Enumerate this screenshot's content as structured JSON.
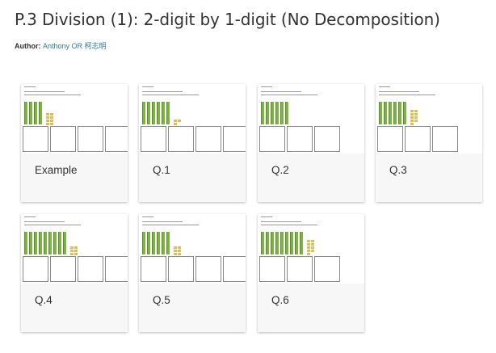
{
  "page": {
    "title": "P.3 Division (1): 2-digit by 1-digit (No Decomposition)",
    "author_label": "Author:",
    "author_name": "Anthony OR 柯志明"
  },
  "colors": {
    "tens_rod": "#7cb342",
    "ones_cube": "#e2bd55",
    "author_link": "#2a7d8f"
  },
  "cards": [
    {
      "label": "Example",
      "tens": 4,
      "ones": 8,
      "boxes": 4
    },
    {
      "label": "Q.1",
      "tens": 6,
      "ones": 3,
      "boxes": 4
    },
    {
      "label": "Q.2",
      "tens": 6,
      "ones": 0,
      "boxes": 3
    },
    {
      "label": "Q.3",
      "tens": 6,
      "ones": 9,
      "boxes": 3
    },
    {
      "label": "Q.4",
      "tens": 9,
      "ones": 6,
      "boxes": 4
    },
    {
      "label": "Q.5",
      "tens": 6,
      "ones": 6,
      "boxes": 4
    },
    {
      "label": "Q.6",
      "tens": 9,
      "ones": 9,
      "boxes": 3
    }
  ]
}
